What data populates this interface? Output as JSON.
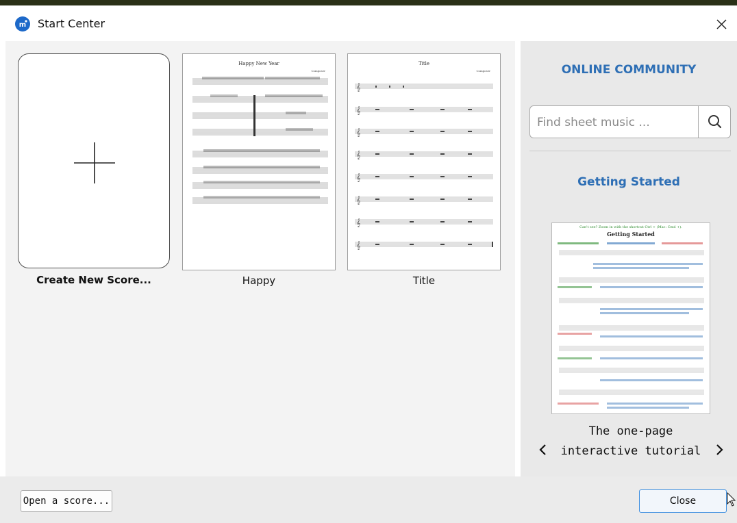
{
  "window": {
    "title": "Start Center",
    "app_icon": "musescore-logo-icon",
    "close_icon": "close-icon"
  },
  "scores": {
    "create_label": "Create New Score...",
    "items": [
      {
        "label": "Happy",
        "sheet_title": "Happy New Year",
        "sheet_composer": "Composer"
      },
      {
        "label": "Title",
        "sheet_title": "Title",
        "sheet_composer": "Composer"
      }
    ]
  },
  "sidebar": {
    "community_heading": "ONLINE COMMUNITY",
    "search_placeholder": "Find sheet music ...",
    "search_icon": "search-icon",
    "getting_started_heading": "Getting Started",
    "tutorial_caption_line1": "The one-page",
    "tutorial_caption_line2": "interactive tutorial",
    "tutorial_header": "Getting Started",
    "tutorial_intro": "Can't see? Zoom in with the shortcut Ctrl + (Mac: Cmd +).",
    "prev_icon": "chevron-left-icon",
    "next_icon": "chevron-right-icon"
  },
  "footer": {
    "open_label": "Open a score...",
    "close_label": "Close"
  },
  "colors": {
    "accent": "#2e6fb5",
    "brand": "#1d69c9",
    "close_border": "#3c8ee0"
  }
}
